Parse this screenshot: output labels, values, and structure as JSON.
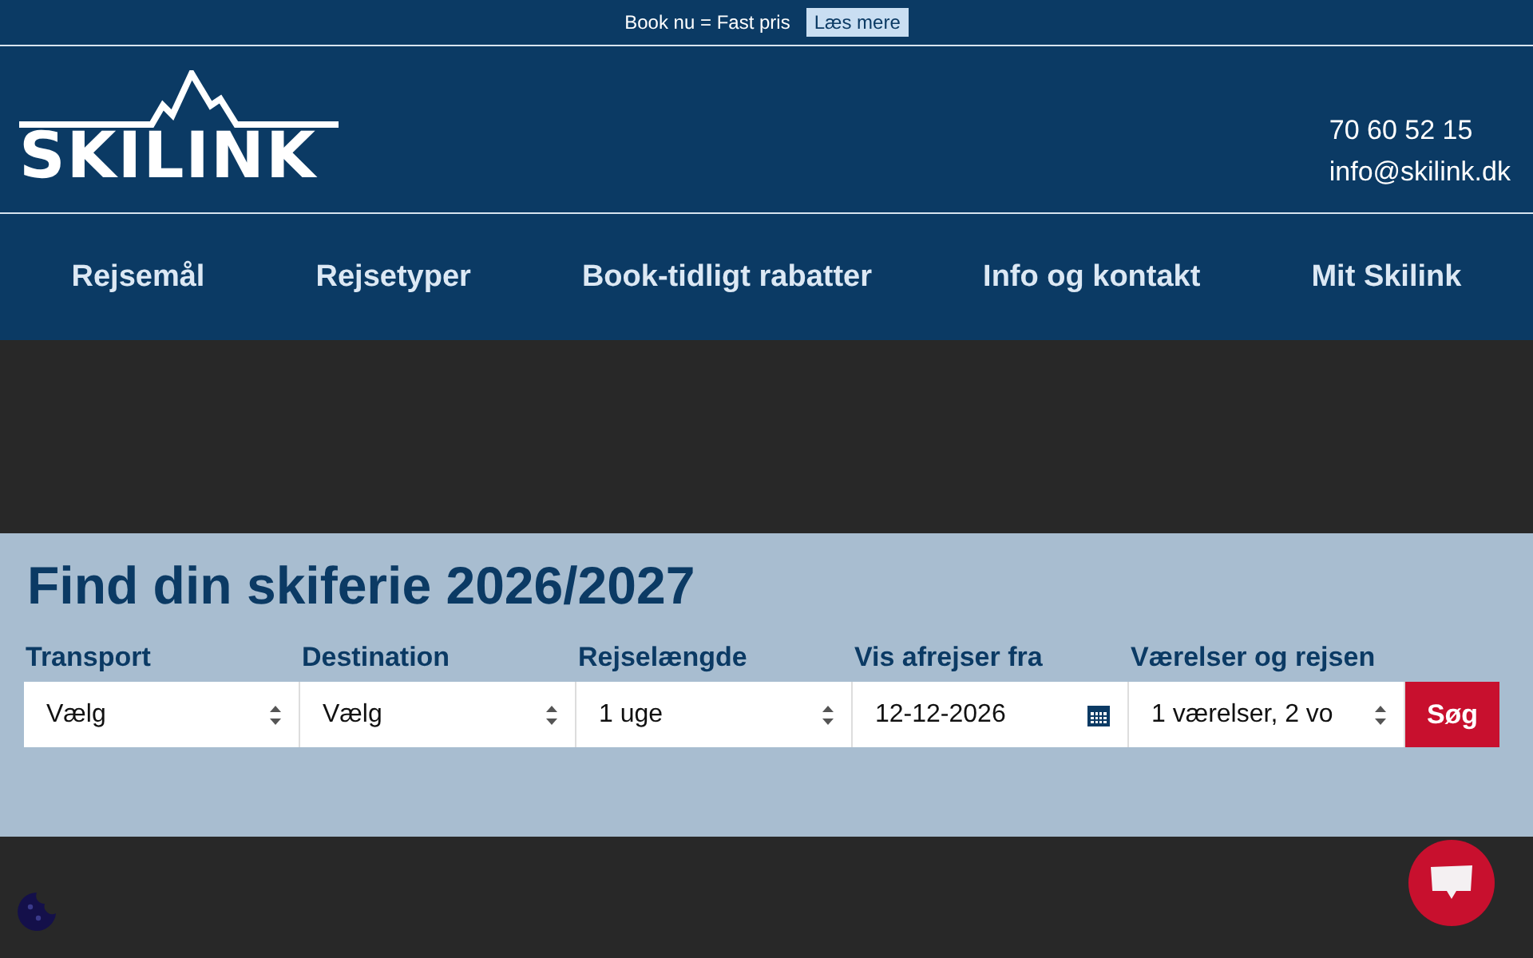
{
  "promo_bar": {
    "text": "Book nu = Fast pris",
    "link": "Læs mere"
  },
  "header": {
    "logo": "SKILINK",
    "phone": "70 60 52 15",
    "email": "info@skilink.dk"
  },
  "nav": [
    "Rejsemål",
    "Rejsetyper",
    "Book-tidligt rabatter",
    "Info og kontakt",
    "Mit Skilink"
  ],
  "search": {
    "title": "Find din skiferie 2026/2027",
    "fields": [
      {
        "kind": "select",
        "label": "Transport",
        "value": "Vælg"
      },
      {
        "kind": "select",
        "label": "Destination",
        "value": "Vælg"
      },
      {
        "kind": "select",
        "label": "Rejselængde",
        "value": "1 uge"
      },
      {
        "kind": "date",
        "label": "Vis afrejser fra",
        "value": "12-12-2026"
      },
      {
        "kind": "select",
        "label": "Værelser og rejsen",
        "value": "1 værelser, 2 vo"
      }
    ],
    "button": "Søg"
  }
}
